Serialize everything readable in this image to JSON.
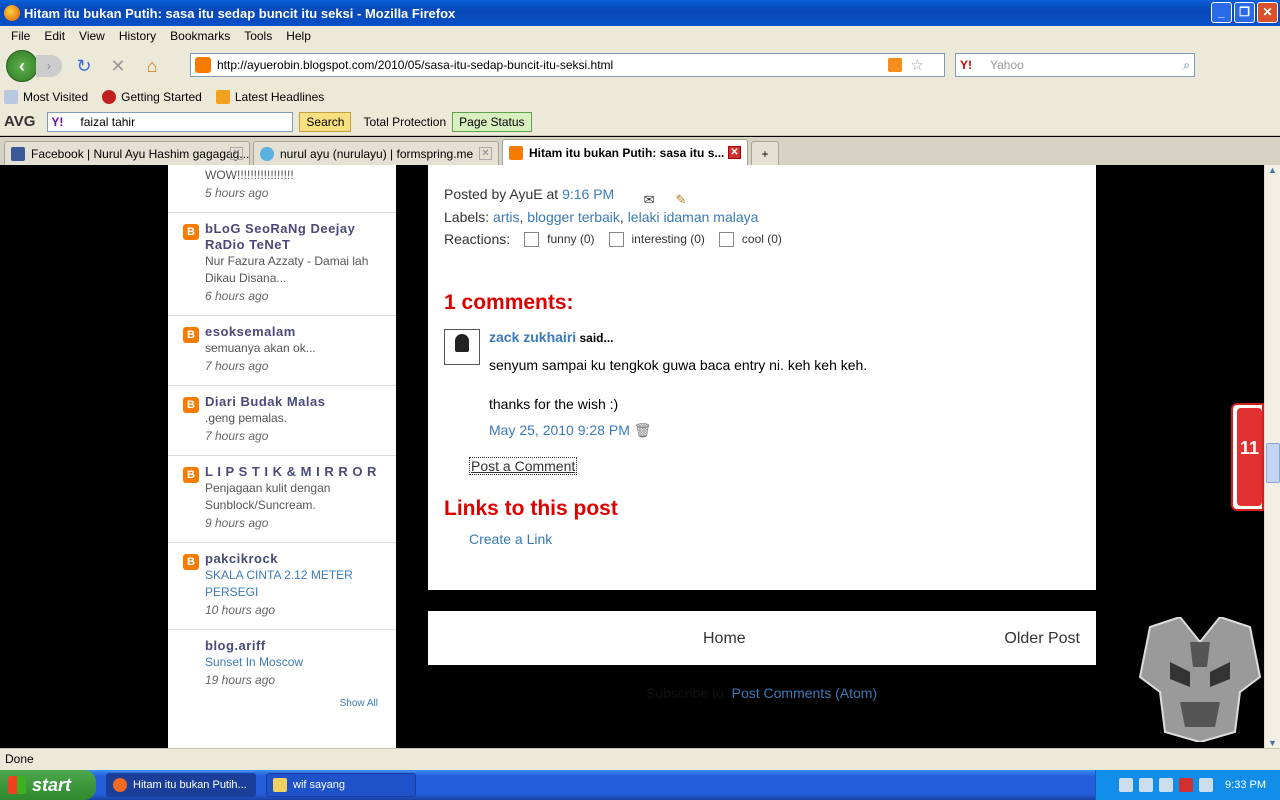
{
  "window": {
    "title": "Hitam itu bukan Putih: sasa itu sedap buncit itu seksi - Mozilla Firefox"
  },
  "menu": [
    "File",
    "Edit",
    "View",
    "History",
    "Bookmarks",
    "Tools",
    "Help"
  ],
  "url": "http://ayuerobin.blogspot.com/2010/05/sasa-itu-sedap-buncit-itu-seksi.html",
  "search": {
    "placeholder": "Yahoo"
  },
  "bookmarks": [
    "Most Visited",
    "Getting Started",
    "Latest Headlines"
  ],
  "avg": {
    "logo": "AVG",
    "query": "faizal tahir",
    "search_label": "Search",
    "protection": "Total Protection",
    "page_status": "Page Status"
  },
  "tabs": [
    {
      "label": "Facebook | Nurul Ayu Hashim gagagag..."
    },
    {
      "label": "nurul ayu (nurulayu) | formspring.me"
    },
    {
      "label": "Hitam itu bukan Putih: sasa itu s..."
    }
  ],
  "sidebar": {
    "top_snippet": "WOW!!!!!!!!!!!!!!!!!",
    "top_time": "5 hours ago",
    "items": [
      {
        "name": "bLoG SeoRaNg Deejay RaDio TeNeT",
        "snippet": "Nur Fazura Azzaty - Damai lah Dikau Disana...",
        "time": "6 hours ago"
      },
      {
        "name": "esoksemalam",
        "snippet": "semuanya akan ok...",
        "time": "7 hours ago"
      },
      {
        "name": "Diari Budak Malas",
        "snippet": ".geng pemalas.",
        "time": "7 hours ago"
      },
      {
        "name": "L I P S T I K & M I R R O R",
        "snippet": "Penjagaan kulit dengan Sunblock/Suncream.",
        "time": "9 hours ago"
      },
      {
        "name": "pakcikrock",
        "snippet": "SKALA CINTA 2.12 METER PERSEGI",
        "time": "10 hours ago"
      },
      {
        "name": "blog.ariff",
        "snippet": "Sunset In Moscow",
        "time": "19 hours ago"
      }
    ],
    "show_all": "Show All"
  },
  "post": {
    "posted_by_label": "Posted by",
    "author": "AyuE",
    "at_label": "at",
    "time": "9:16 PM",
    "labels_label": "Labels:",
    "labels": [
      "artis",
      "blogger terbaik",
      "lelaki idaman malaya"
    ],
    "reactions_label": "Reactions:",
    "reactions": [
      "funny (0)",
      "interesting (0)",
      "cool (0)"
    ]
  },
  "comments": {
    "heading": "1 comments:",
    "items": [
      {
        "author": "zack zukhairi",
        "said": "said...",
        "line1": "senyum sampai ku tengkok guwa baca entry ni. keh keh keh.",
        "line2": "thanks for the wish :)",
        "date": "May 25, 2010 9:28 PM"
      }
    ],
    "post_comment": "Post a Comment"
  },
  "links": {
    "heading": "Links to this post",
    "create": "Create a Link"
  },
  "pager": {
    "home": "Home",
    "older": "Older Post"
  },
  "subscribe": {
    "label": "Subscribe to:",
    "link": "Post Comments (Atom)"
  },
  "side_badge": "11",
  "status": "Done",
  "taskbar": {
    "start": "start",
    "tasks": [
      "Hitam itu bukan Putih...",
      "wif sayang"
    ],
    "clock": "9:33 PM"
  }
}
